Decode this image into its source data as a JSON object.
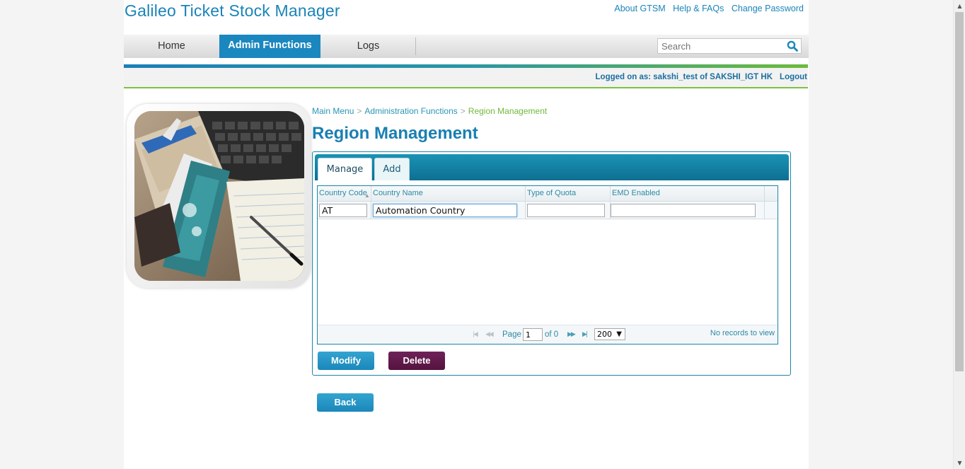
{
  "app": {
    "title": "Galileo Ticket Stock Manager"
  },
  "toplinks": {
    "about": "About GTSM",
    "help": "Help & FAQs",
    "change_password": "Change Password"
  },
  "nav": {
    "items": [
      "Home",
      "Admin Functions",
      "Logs"
    ],
    "active": "Admin Functions"
  },
  "search": {
    "placeholder": "Search",
    "icon": "search-icon"
  },
  "session": {
    "logged_text": "Logged on as: sakshi_test of SAKSHI_IGT HK",
    "logout": "Logout"
  },
  "breadcrumb": {
    "main_menu": "Main Menu",
    "admin": "Administration Functions",
    "current": "Region Management",
    "separator": ">"
  },
  "page": {
    "title": "Region Management"
  },
  "tabs": {
    "manage": "Manage",
    "add": "Add",
    "active": "Manage"
  },
  "grid": {
    "columns": [
      "Country Code",
      "Country Name",
      "Type of Quota",
      "EMD Enabled"
    ],
    "filters": {
      "country_code": "AT",
      "country_name": "Automation Country",
      "type_of_quota": "",
      "emd_enabled": ""
    },
    "sort_icon": "sort-asc-icon"
  },
  "pager": {
    "page_label": "Page",
    "page_value": "1",
    "of_label": "of 0",
    "page_size": "200",
    "records_text": "No records to view"
  },
  "buttons": {
    "modify": "Modify",
    "delete": "Delete",
    "back": "Back"
  },
  "colors": {
    "brand_blue": "#1b87bf",
    "accent_green": "#7cc142",
    "delete_purple": "#5e1a4a"
  }
}
